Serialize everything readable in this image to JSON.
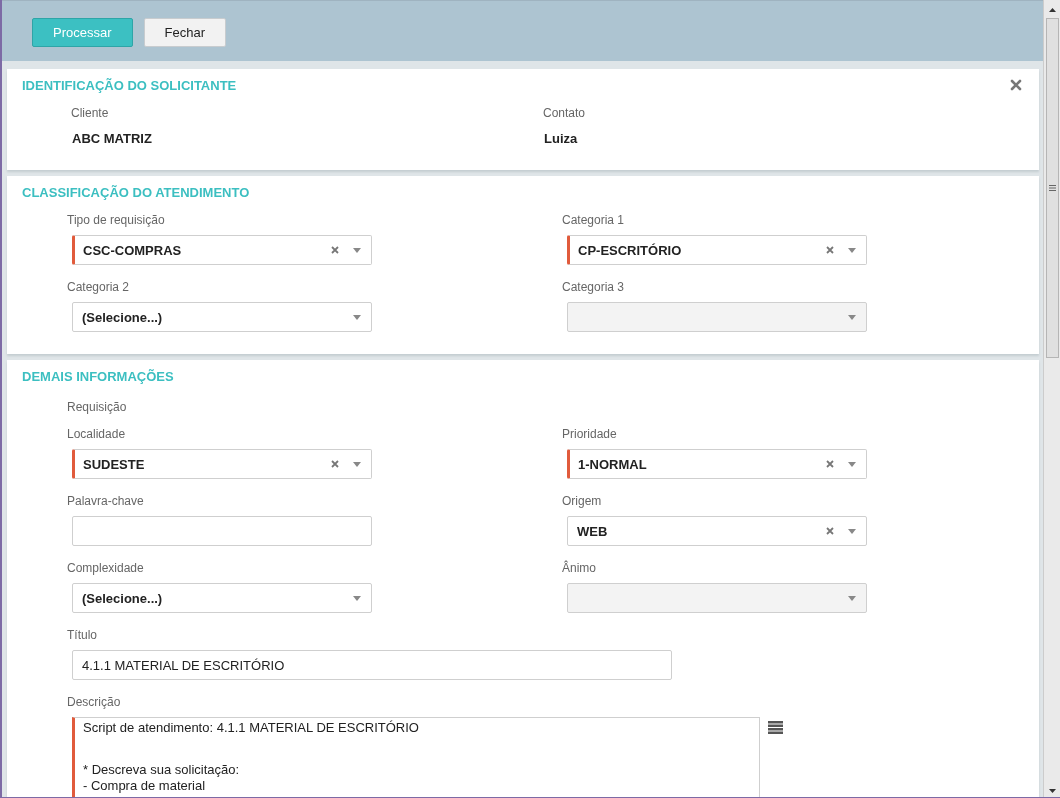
{
  "toolbar": {
    "buttons": [
      {
        "label": "Processar",
        "kind": "primary"
      },
      {
        "label": "Fechar",
        "kind": "default"
      }
    ]
  },
  "sections": [
    {
      "title": "IDENTIFICAÇÃO DO SOLICITANTE",
      "closable": true,
      "kind": "info",
      "fields": [
        {
          "label": "Cliente",
          "value": "ABC MATRIZ"
        },
        {
          "label": "Contato",
          "value": "Luiza"
        }
      ]
    },
    {
      "title": "CLASSIFICAÇÃO DO ATENDIMENTO",
      "kind": "form",
      "fields": [
        {
          "kind": "select",
          "label": "Tipo de requisição",
          "value": "CSC-COMPRAS",
          "required": true,
          "clearable": true,
          "disabled": false
        },
        {
          "kind": "select",
          "label": "Categoria 1",
          "value": "CP-ESCRITÓRIO",
          "required": true,
          "clearable": true,
          "disabled": false
        },
        {
          "kind": "select",
          "label": "Categoria 2",
          "value": "(Selecione...)",
          "required": false,
          "disabled": false
        },
        {
          "kind": "select",
          "label": "Categoria 3",
          "required": false,
          "disabled": true
        }
      ]
    },
    {
      "title": "DEMAIS INFORMAÇÕES",
      "kind": "form",
      "fields": [
        {
          "kind": "heading",
          "label": "Requisição"
        },
        {
          "kind": "select",
          "label": "Localidade",
          "value": "SUDESTE",
          "required": true,
          "clearable": true,
          "disabled": false
        },
        {
          "kind": "select",
          "label": "Prioridade",
          "value": "1-NORMAL",
          "required": true,
          "clearable": true,
          "disabled": false
        },
        {
          "kind": "text",
          "label": "Palavra-chave",
          "required": false
        },
        {
          "kind": "select",
          "label": "Origem",
          "value": "WEB",
          "required": false,
          "clearable": true,
          "disabled": false
        },
        {
          "kind": "select",
          "label": "Complexidade",
          "value": "(Selecione...)",
          "required": false,
          "disabled": false
        },
        {
          "kind": "select",
          "label": "Ânimo",
          "required": false,
          "disabled": true
        },
        {
          "kind": "long-text",
          "label": "Título",
          "value": "4.1.1 MATERIAL DE ESCRITÓRIO",
          "required": false
        },
        {
          "kind": "textarea",
          "label": "Descrição",
          "required": true,
          "paragraphs": [
            [
              "Script de atendimento: 4.1.1 MATERIAL DE ESCRITÓRIO"
            ],
            [
              "* Descreva sua solicitação:",
              "- Compra de material"
            ]
          ]
        }
      ]
    }
  ]
}
